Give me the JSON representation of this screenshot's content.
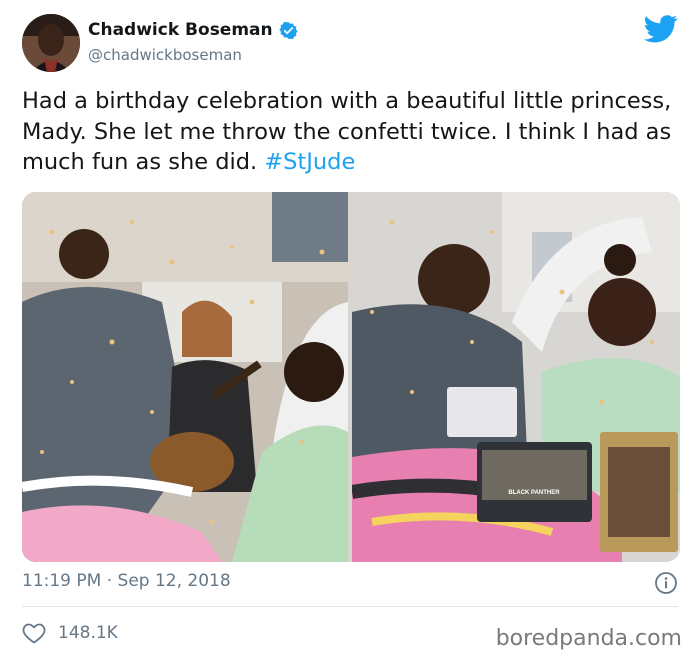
{
  "author": {
    "name": "Chadwick Boseman",
    "handle": "@chadwickboseman",
    "verified": true
  },
  "tweet": {
    "text": "Had a birthday celebration with a beautiful little princess, Mady. She let me throw the confetti twice. I think I had as much fun as she did.",
    "hashtag": "#StJude"
  },
  "meta": {
    "timestamp": "11:19 PM · Sep 12, 2018"
  },
  "engagement": {
    "likes": "148.1K"
  },
  "watermark": "boredpanda.com",
  "photo_text": {
    "toy_box": "BLACK PANTHER"
  },
  "icons": {
    "verified": "verified-badge-icon",
    "brand": "twitter-bird-icon",
    "info": "info-icon",
    "like": "heart-icon"
  },
  "colors": {
    "accent": "#1da1f2",
    "text": "#14171a",
    "secondary": "#657786",
    "divider": "#e1e8ed"
  }
}
